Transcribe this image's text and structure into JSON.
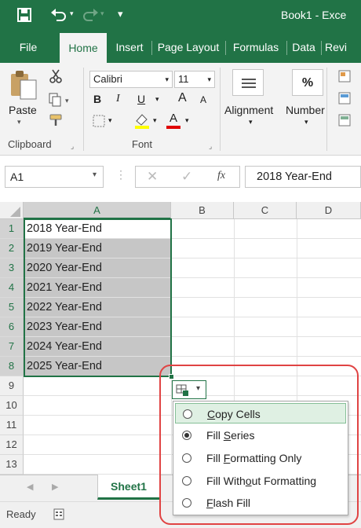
{
  "titlebar": {
    "title": "Book1 - Exce"
  },
  "tabs": [
    "File",
    "Home",
    "Insert",
    "Page Layout",
    "Formulas",
    "Data",
    "Revi"
  ],
  "ribbon": {
    "clipboard": {
      "paste": "Paste",
      "group": "Clipboard"
    },
    "font": {
      "name": "Calibri",
      "size": "11",
      "bold": "B",
      "italic": "I",
      "underline": "U",
      "grow": "A",
      "shrink": "A",
      "fontcolor": "A",
      "group": "Font"
    },
    "alignment": "Alignment",
    "number": "Number",
    "number_sym": "%"
  },
  "formula_bar": {
    "namebox": "A1",
    "fx": "fx",
    "value": "2018 Year-End"
  },
  "columns": [
    "A",
    "B",
    "C",
    "D"
  ],
  "rows": [
    "1",
    "2",
    "3",
    "4",
    "5",
    "6",
    "7",
    "8",
    "9",
    "10",
    "11",
    "12",
    "13"
  ],
  "cells_a": [
    "2018 Year-End",
    "2019 Year-End",
    "2020 Year-End",
    "2021 Year-End",
    "2022 Year-End",
    "2023 Year-End",
    "2024 Year-End",
    "2025 Year-End"
  ],
  "sheet_tab": "Sheet1",
  "status": "Ready",
  "autofill_menu": [
    {
      "pre": "",
      "acc": "C",
      "post": "opy Cells",
      "selected": false
    },
    {
      "pre": "Fill ",
      "acc": "S",
      "post": "eries",
      "selected": true
    },
    {
      "pre": "Fill ",
      "acc": "F",
      "post": "ormatting Only",
      "selected": false
    },
    {
      "pre": "Fill With",
      "acc": "o",
      "post": "ut Formatting",
      "selected": false
    },
    {
      "pre": "",
      "acc": "F",
      "post": "lash Fill",
      "selected": false
    }
  ],
  "colors": {
    "excel_green": "#217346",
    "selection_fill": "#c6c6c6",
    "menu_hover": "#dff0e3",
    "highlight": "#e04343"
  }
}
